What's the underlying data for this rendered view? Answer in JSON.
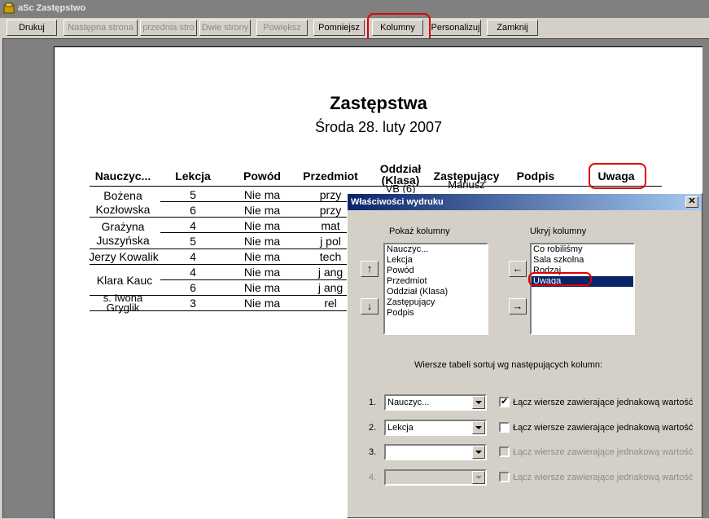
{
  "window": {
    "title": "aSc Zastępstwo"
  },
  "toolbar": [
    {
      "label": "Drukuj",
      "enabled": true
    },
    {
      "label": "Następna strona",
      "enabled": false
    },
    {
      "label": "przednia stro",
      "enabled": false
    },
    {
      "label": "Dwie strony",
      "enabled": false
    },
    {
      "label": "Powiększ",
      "enabled": false
    },
    {
      "label": "Pomniejsz",
      "enabled": true
    },
    {
      "label": "Kolumny",
      "enabled": true
    },
    {
      "label": "Personalizuj",
      "enabled": true
    },
    {
      "label": "Zamknij",
      "enabled": true
    }
  ],
  "document": {
    "title": "Zastępstwa",
    "subtitle": "Środa 28. luty 2007",
    "headers": [
      "Nauczyc...",
      "Lekcja",
      "Powód",
      "Przedmiot",
      "Oddział (Klasa)",
      "Zastępujący",
      "Podpis",
      "Uwaga"
    ],
    "clipped_texts": {
      "oddzial_value": "VB (6)",
      "zastepujacy_value": "Mariusz"
    },
    "teachers": [
      "Bożena Kozłowska",
      "Grażyna Juszyńska",
      "Jerzy Kowalik",
      "Klara Kauc",
      "s. Iwona Gryglik"
    ],
    "rows": [
      {
        "lekcja": "5",
        "powod": "Nie ma",
        "przedmiot": "przy"
      },
      {
        "lekcja": "6",
        "powod": "Nie ma",
        "przedmiot": "przy"
      },
      {
        "lekcja": "4",
        "powod": "Nie ma",
        "przedmiot": "mat"
      },
      {
        "lekcja": "5",
        "powod": "Nie ma",
        "przedmiot": "j pol"
      },
      {
        "lekcja": "4",
        "powod": "Nie ma",
        "przedmiot": "tech"
      },
      {
        "lekcja": "4",
        "powod": "Nie ma",
        "przedmiot": "j ang"
      },
      {
        "lekcja": "6",
        "powod": "Nie ma",
        "przedmiot": "j ang"
      },
      {
        "lekcja": "3",
        "powod": "Nie ma",
        "przedmiot": "rel"
      }
    ]
  },
  "dialog": {
    "title": "Właściwości wydruku",
    "close_label": "✕",
    "show_columns_label": "Pokaż kolumny",
    "hide_columns_label": "Ukryj kolumny",
    "show_columns": [
      "Nauczyc...",
      "Lekcja",
      "Powód",
      "Przedmiot",
      "Oddział (Klasa)",
      "Zastępujący",
      "Podpis"
    ],
    "hide_columns": [
      "Co robiliśmy",
      "Sala szkolna",
      "Rodzaj",
      "Uwaga"
    ],
    "hide_selected": "Uwaga",
    "up_arrow": "↑",
    "down_arrow": "↓",
    "left_arrow": "←",
    "right_arrow": "→",
    "sort_label": "Wiersze tabeli sortuj wg następujących kolumn:",
    "sort_rows": [
      {
        "num": "1.",
        "value": "Nauczyc...",
        "checked": true,
        "enabled": true,
        "merge_label": "Łącz wiersze zawierające jednakową wartość"
      },
      {
        "num": "2.",
        "value": "Lekcja",
        "checked": false,
        "enabled": true,
        "merge_label": "Łącz wiersze zawierające jednakową wartość"
      },
      {
        "num": "3.",
        "value": "",
        "checked": false,
        "enabled": true,
        "merge_label": "Łącz wiersze zawierające jednakową wartość"
      },
      {
        "num": "4.",
        "value": "",
        "checked": false,
        "enabled": false,
        "merge_label": "Łącz wiersze zawierające jednakową wartość"
      }
    ],
    "check_mark": "✔"
  },
  "colors": {
    "highlight_ring": "#e00000",
    "selection": "#0a246a",
    "face": "#d4d0c8"
  }
}
